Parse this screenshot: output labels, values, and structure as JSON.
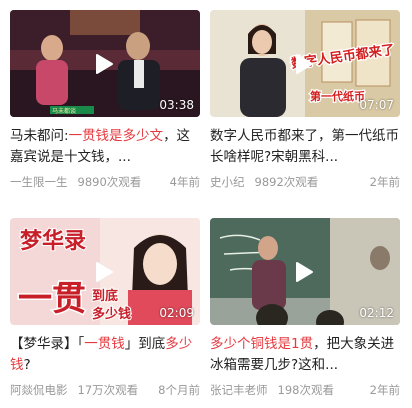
{
  "cards": [
    {
      "duration": "03:38",
      "title_parts": [
        "马未都问:",
        "一贯钱是多少文",
        "，这嘉宾说是十文钱，..."
      ],
      "author": "一生限一生",
      "views": "9890次观看",
      "time": "4年前",
      "thumb_text": "马未都谈"
    },
    {
      "duration": "07:07",
      "title_parts": [
        "数字人民币都来了，第一代纸币长啥样呢?宋朝黑科..."
      ],
      "author": "史小纪",
      "views": "9892次观看",
      "time": "2年前",
      "thumb_text": [
        "数字人民币都来了",
        "第一代纸币"
      ]
    },
    {
      "duration": "02:09",
      "title_parts": [
        "【梦华录】「",
        "一贯钱",
        "」到底",
        "多少钱",
        "?"
      ],
      "author": "阿燚侃电影",
      "views": "17万次观看",
      "time": "8个月前",
      "thumb_text": [
        "梦华录",
        "一贯",
        "到底",
        "多少钱"
      ]
    },
    {
      "duration": "02:12",
      "title_parts": [
        "多少个铜钱是1贯",
        "，把大象关进冰箱需要几步?这和..."
      ],
      "author": "张记丰老师",
      "views": "198次观看",
      "time": "2年前"
    }
  ],
  "colors": {
    "highlight": "#e6393e",
    "meta": "#999999",
    "title": "#222222"
  },
  "icons": {
    "play": "play-icon"
  }
}
